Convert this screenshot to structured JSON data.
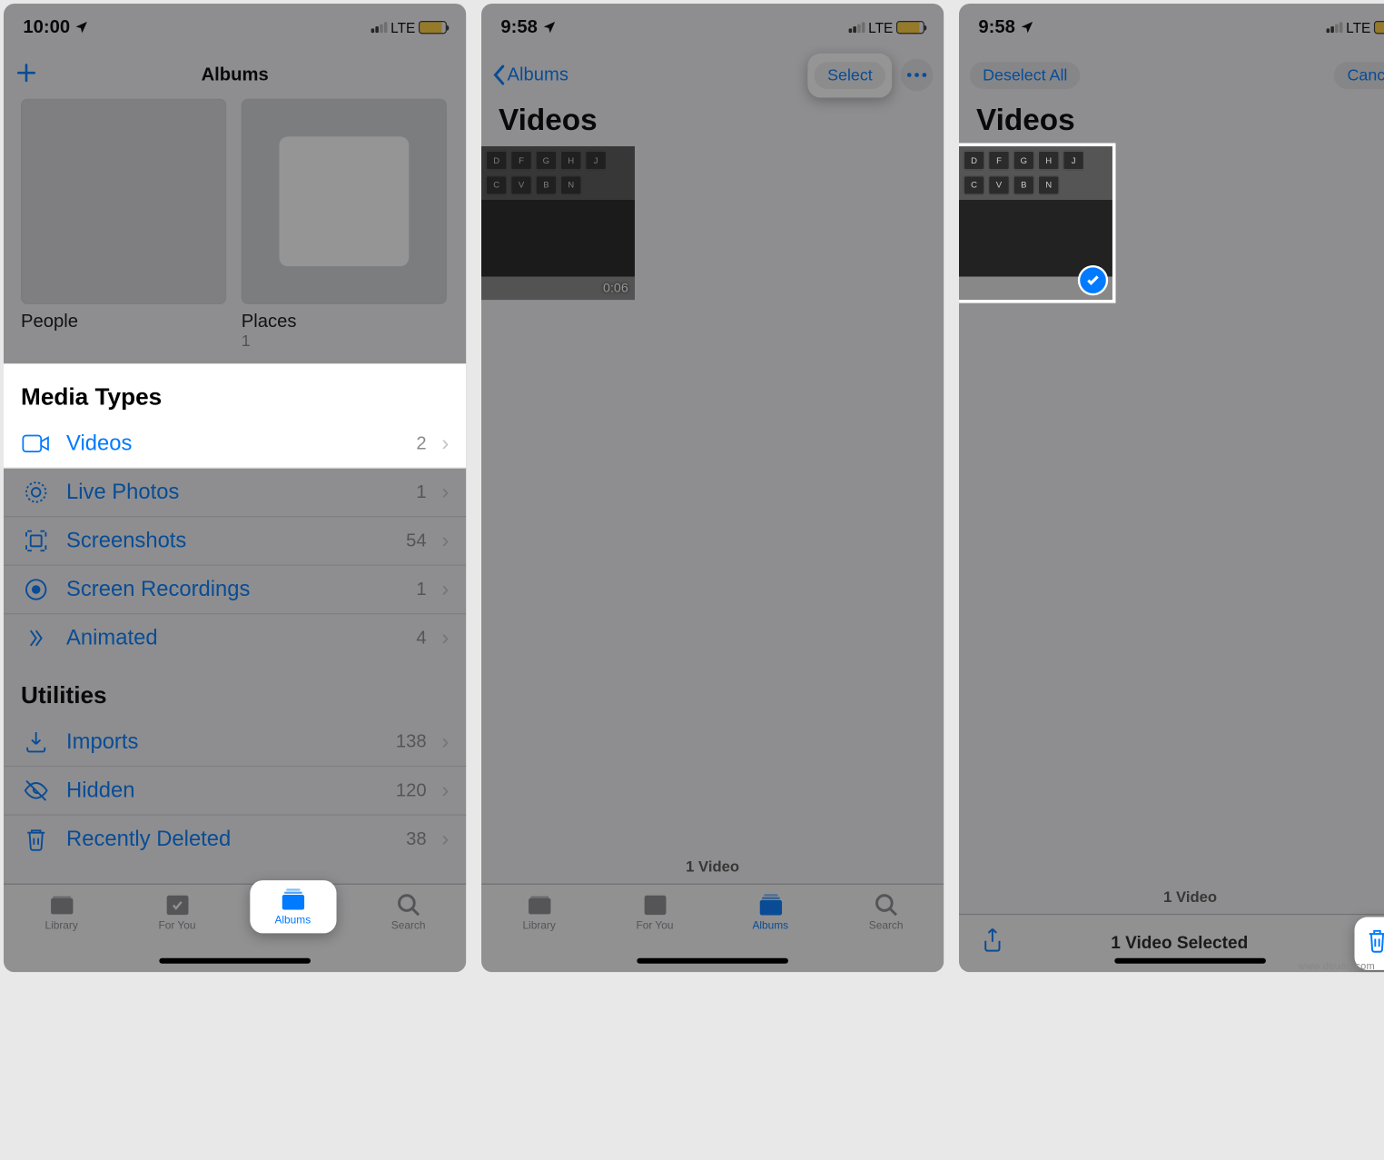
{
  "screen1": {
    "time": "10:00",
    "net": "LTE",
    "nav_title": "Albums",
    "albums": [
      {
        "label": "People",
        "count": ""
      },
      {
        "label": "Places",
        "count": "1"
      }
    ],
    "section_media": "Media Types",
    "media_rows": [
      {
        "icon": "video",
        "label": "Videos",
        "count": "2"
      },
      {
        "icon": "live",
        "label": "Live Photos",
        "count": "1"
      },
      {
        "icon": "screenshot",
        "label": "Screenshots",
        "count": "54"
      },
      {
        "icon": "record",
        "label": "Screen Recordings",
        "count": "1"
      },
      {
        "icon": "animated",
        "label": "Animated",
        "count": "4"
      }
    ],
    "section_utilities": "Utilities",
    "utility_rows": [
      {
        "icon": "imports",
        "label": "Imports",
        "count": "138"
      },
      {
        "icon": "hidden",
        "label": "Hidden",
        "count": "120"
      },
      {
        "icon": "deleted",
        "label": "Recently Deleted",
        "count": "38"
      }
    ],
    "tabs": {
      "library": "Library",
      "for_you": "For You",
      "albums": "Albums",
      "search": "Search"
    }
  },
  "screen2": {
    "time": "9:58",
    "net": "LTE",
    "back_label": "Albums",
    "title": "Videos",
    "select_label": "Select",
    "video_duration": "0:06",
    "summary": "1 Video",
    "tabs": {
      "library": "Library",
      "for_you": "For You",
      "albums": "Albums",
      "search": "Search"
    }
  },
  "screen3": {
    "time": "9:58",
    "net": "LTE",
    "deselect_label": "Deselect All",
    "cancel_label": "Cancel",
    "title": "Videos",
    "summary": "1 Video",
    "selected_text": "1 Video Selected"
  },
  "watermark": "www.deuaq.com"
}
